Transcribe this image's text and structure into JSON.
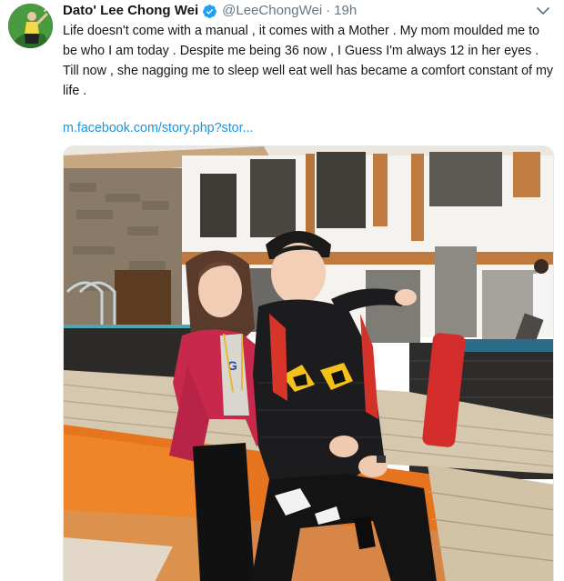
{
  "tweet": {
    "display_name": "Dato' Lee Chong Wei",
    "handle": "@LeeChongWei",
    "separator": "·",
    "time": "19h",
    "text": "Life doesn't come with a manual , it comes with a Mother . My mom moulded me to be who I am today . Despite me being 36 now , I Guess I'm always 12 in her eyes . Till now , she nagging me to sleep well eat well has became a comfort constant of my life .",
    "link": "m.facebook.com/story.php?stor...",
    "icons": {
      "verified": "verified-badge-icon",
      "caret": "chevron-down-icon"
    }
  },
  "colors": {
    "name": "#14171a",
    "secondary": "#657786",
    "link": "#1b95e0",
    "verified": "#1da1f2"
  }
}
